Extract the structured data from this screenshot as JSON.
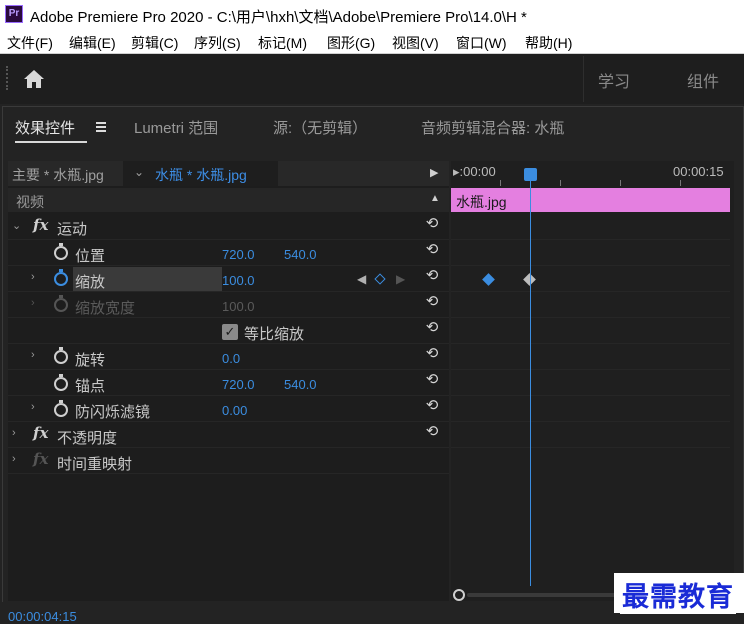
{
  "window": {
    "title": "Adobe Premiere Pro 2020 - C:\\用户\\hxh\\文档\\Adobe\\Premiere Pro\\14.0\\H *",
    "app_icon": "Pr"
  },
  "menu": [
    "文件(F)",
    "编辑(E)",
    "剪辑(C)",
    "序列(S)",
    "标记(M)",
    "图形(G)",
    "视图(V)",
    "窗口(W)",
    "帮助(H)"
  ],
  "workspaces": [
    "学习",
    "组件"
  ],
  "tabs": [
    "效果控件",
    "Lumetri 范围",
    "源:（无剪辑）",
    "音频剪辑混合器: 水瓶"
  ],
  "source": {
    "main": "主要 * 水瓶.jpg",
    "clip": "水瓶 * 水瓶.jpg"
  },
  "section": {
    "video": "视频"
  },
  "effects": {
    "motion": "运动",
    "position": {
      "label": "位置",
      "x": "720.0",
      "y": "540.0"
    },
    "scale": {
      "label": "缩放",
      "value": "100.0"
    },
    "scale_width": {
      "label": "缩放宽度",
      "value": "100.0"
    },
    "uniform_scale": {
      "label": "等比缩放",
      "checked": true
    },
    "rotation": {
      "label": "旋转",
      "value": "0.0"
    },
    "anchor": {
      "label": "锚点",
      "x": "720.0",
      "y": "540.0"
    },
    "anti_flicker": {
      "label": "防闪烁滤镜",
      "value": "0.00"
    },
    "opacity": "不透明度",
    "time_remap": "时间重映射"
  },
  "timeline": {
    "start": "▸:00:00",
    "end": "00:00:15",
    "clip_name": "水瓶.jpg"
  },
  "status": {
    "timecode": "00:00:04:15"
  },
  "watermark": "最需教育",
  "colors": {
    "accent": "#3b8de0",
    "clip": "#e47fe0"
  }
}
